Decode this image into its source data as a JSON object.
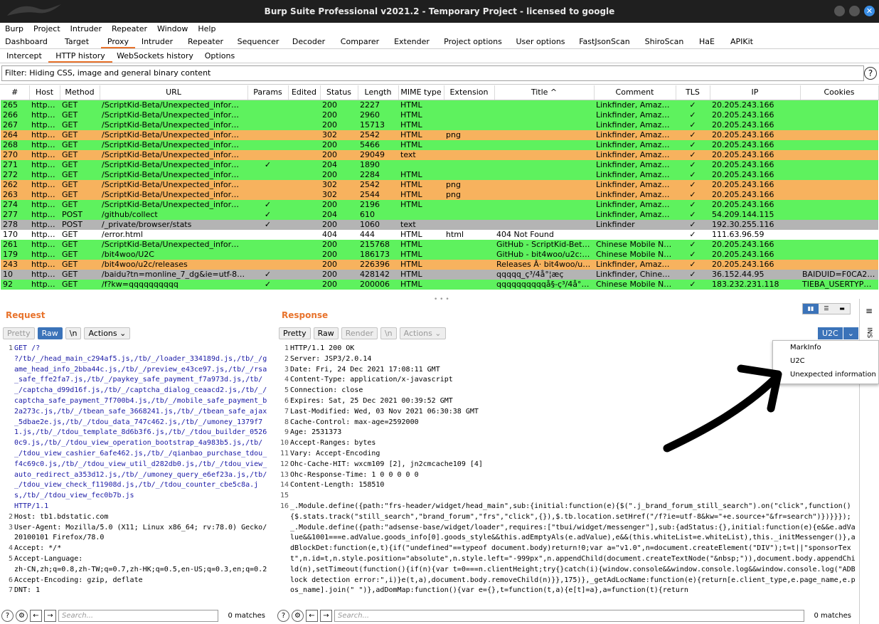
{
  "window": {
    "title": "Burp Suite Professional v2021.2 - Temporary Project - licensed to google"
  },
  "menu": [
    "Burp",
    "Project",
    "Intruder",
    "Repeater",
    "Window",
    "Help"
  ],
  "main_tabs": [
    "Dashboard",
    "Target",
    "Proxy",
    "Intruder",
    "Repeater",
    "Sequencer",
    "Decoder",
    "Comparer",
    "Extender",
    "Project options",
    "User options",
    "FastJsonScan",
    "ShiroScan",
    "HaE",
    "APIKit"
  ],
  "sub_tabs": [
    "Intercept",
    "HTTP history",
    "WebSockets history",
    "Options"
  ],
  "filter": "Filter: Hiding CSS, image and general binary content",
  "columns": [
    "#",
    "Host",
    "Method",
    "URL",
    "Params",
    "Edited",
    "Status",
    "Length",
    "MIME type",
    "Extension",
    "Title ^",
    "Comment",
    "TLS",
    "IP",
    "Cookies"
  ],
  "rows": [
    [
      "265",
      "https:...",
      "GET",
      "/ScriptKid-Beta/Unexpected_information...",
      "",
      "",
      "200",
      "2227",
      "HTML",
      "",
      "",
      "Linkfinder, Amazon...",
      "✓",
      "20.205.243.166",
      "",
      "#5ef25e"
    ],
    [
      "266",
      "https:...",
      "GET",
      "/ScriptKid-Beta/Unexpected_information...",
      "",
      "",
      "200",
      "2960",
      "HTML",
      "",
      "",
      "Linkfinder, Amazon...",
      "✓",
      "20.205.243.166",
      "",
      "#5ef25e"
    ],
    [
      "267",
      "https:...",
      "GET",
      "/ScriptKid-Beta/Unexpected_information...",
      "",
      "",
      "200",
      "15713",
      "HTML",
      "",
      "",
      "Linkfinder, Amazon...",
      "✓",
      "20.205.243.166",
      "",
      "#5ef25e"
    ],
    [
      "264",
      "https:...",
      "GET",
      "/ScriptKid-Beta/Unexpected_information...",
      "",
      "",
      "302",
      "2542",
      "HTML",
      "png",
      "",
      "Linkfinder, Amazon...",
      "✓",
      "20.205.243.166",
      "",
      "#f7b25e"
    ],
    [
      "268",
      "https:...",
      "GET",
      "/ScriptKid-Beta/Unexpected_information...",
      "",
      "",
      "200",
      "5466",
      "HTML",
      "",
      "",
      "Linkfinder, Amazon...",
      "✓",
      "20.205.243.166",
      "",
      "#5ef25e"
    ],
    [
      "270",
      "https:...",
      "GET",
      "/ScriptKid-Beta/Unexpected_information...",
      "",
      "",
      "200",
      "29049",
      "text",
      "",
      "",
      "Linkfinder, Amazon...",
      "✓",
      "20.205.243.166",
      "",
      "#f7b25e"
    ],
    [
      "271",
      "https:...",
      "GET",
      "/ScriptKid-Beta/Unexpected_information...",
      "✓",
      "",
      "204",
      "1890",
      "",
      "",
      "",
      "Linkfinder, Amazon...",
      "✓",
      "20.205.243.166",
      "",
      "#5ef25e"
    ],
    [
      "272",
      "https:...",
      "GET",
      "/ScriptKid-Beta/Unexpected_information...",
      "",
      "",
      "200",
      "2284",
      "HTML",
      "",
      "",
      "Linkfinder, Amazon...",
      "✓",
      "20.205.243.166",
      "",
      "#5ef25e"
    ],
    [
      "262",
      "https:...",
      "GET",
      "/ScriptKid-Beta/Unexpected_information...",
      "",
      "",
      "302",
      "2542",
      "HTML",
      "png",
      "",
      "Linkfinder, Amazon...",
      "✓",
      "20.205.243.166",
      "",
      "#f7b25e"
    ],
    [
      "263",
      "https:...",
      "GET",
      "/ScriptKid-Beta/Unexpected_information...",
      "",
      "",
      "302",
      "2544",
      "HTML",
      "png",
      "",
      "Linkfinder, Amazon...",
      "✓",
      "20.205.243.166",
      "",
      "#f7b25e"
    ],
    [
      "274",
      "https:...",
      "GET",
      "/ScriptKid-Beta/Unexpected_information...",
      "✓",
      "",
      "200",
      "2196",
      "HTML",
      "",
      "",
      "Linkfinder, Amazon...",
      "✓",
      "20.205.243.166",
      "",
      "#5ef25e"
    ],
    [
      "277",
      "https:...",
      "POST",
      "/github/collect",
      "✓",
      "",
      "204",
      "610",
      "",
      "",
      "",
      "Linkfinder, Amazon...",
      "✓",
      "54.209.144.115",
      "",
      "#5ef25e"
    ],
    [
      "278",
      "https:...",
      "POST",
      "/_private/browser/stats",
      "✓",
      "",
      "200",
      "1060",
      "text",
      "",
      "",
      "Linkfinder",
      "✓",
      "192.30.255.116",
      "",
      "#b4b4b4"
    ],
    [
      "170",
      "https:...",
      "GET",
      "/error.html",
      "",
      "",
      "404",
      "444",
      "HTML",
      "html",
      "404 Not Found",
      "",
      "✓",
      "111.63.96.59",
      "",
      "#ffffff"
    ],
    [
      "261",
      "https:...",
      "GET",
      "/ScriptKid-Beta/Unexpected_information",
      "",
      "",
      "200",
      "215768",
      "HTML",
      "",
      "GitHub - ScriptKid-Beta/U...",
      "Chinese Mobile Nu...",
      "✓",
      "20.205.243.166",
      "",
      "#5ef25e"
    ],
    [
      "179",
      "https:...",
      "GET",
      "/bit4woo/U2C",
      "",
      "",
      "200",
      "186173",
      "HTML",
      "",
      "GitHub - bit4woo/u2c: Uni...",
      "Chinese Mobile Nu...",
      "✓",
      "20.205.243.166",
      "",
      "#5ef25e"
    ],
    [
      "243",
      "https:...",
      "GET",
      "/bit4woo/u2c/releases",
      "",
      "",
      "200",
      "226396",
      "HTML",
      "",
      "Releases Â· bit4woo/u2c Â...",
      "Linkfinder, Amazon...",
      "✓",
      "20.205.243.166",
      "",
      "#f7b25e"
    ],
    [
      "10",
      "https:...",
      "GET",
      "/baidu?tn=monline_7_dg&ie=utf-8&wd=...",
      "✓",
      "",
      "200",
      "428142",
      "HTML",
      "",
      "qqqqq_ç³/4å°¦æç",
      "Linkfinder, Chinese...",
      "✓",
      "36.152.44.95",
      "BAIDUID=F0CA26E...",
      "#b4b4b4"
    ],
    [
      "92",
      "https:...",
      "GET",
      "/f?kw=qqqqqqqqqq",
      "✓",
      "",
      "200",
      "200006",
      "HTML",
      "",
      "qqqqqqqqqqå§-ç³/4å°¦è¨...",
      "Chinese Mobile Nu...",
      "✓",
      "183.232.231.118",
      "TIEBA_USERTYPE=...",
      "#5ef25e"
    ]
  ],
  "request": {
    "header": "Request",
    "tools": [
      "Pretty",
      "Raw",
      "\\n",
      "Actions ⌄"
    ],
    "lines": [
      [
        "1",
        "GET /?\n?/tb/_/head_main_c294af5.js,/tb/_/loader_334189d.js,/tb/_/game_head_info_2bba44c.js,/tb/_/preview_e43ce97.js,/tb/_/rsa_safe_ffe2fa7.js,/tb/_/paykey_safe_payment_f7a973d.js,/tb/_/captcha_d99d16f.js,/tb/_/captcha_dialog_ceaacd2.js,/tb/_/captcha_safe_payment_7f700b4.js,/tb/_/mobile_safe_payment_b2a273c.js,/tb/_/tbean_safe_3668241.js,/tb/_/tbean_safe_ajax_5dbae2e.js,/tb/_/tdou_data_747c462.js,/tb/_/umoney_1379f71.js,/tb/_/tdou_template_8d6b3f6.js,/tb/_/tdou_builder_05260c9.js,/tb/_/tdou_view_operation_bootstrap_4a983b5.js,/tb/_/tdou_view_cashier_6afe462.js,/tb/_/qianbao_purchase_tdou_f4c69c0.js,/tb/_/tdou_view_util_d282db0.js,/tb/_/tdou_view_auto_redirect_a353d12.js,/tb/_/umoney_query_e6ef23a.js,/tb/_/tdou_view_check_f11908d.js,/tb/_/tdou_counter_cbe5c8a.js,/tb/_/tdou_view_fec0b7b.js\nHTTP/1.1"
      ],
      [
        "2",
        "Host: tb1.bdstatic.com"
      ],
      [
        "3",
        "User-Agent: Mozilla/5.0 (X11; Linux x86_64; rv:78.0) Gecko/20100101 Firefox/78.0"
      ],
      [
        "4",
        "Accept: */*"
      ],
      [
        "5",
        "Accept-Language:\nzh-CN,zh;q=0.8,zh-TW;q=0.7,zh-HK;q=0.5,en-US;q=0.3,en;q=0.2"
      ],
      [
        "6",
        "Accept-Encoding: gzip, deflate"
      ],
      [
        "7",
        "DNT: 1"
      ]
    ],
    "search_placeholder": "Search...",
    "matches": "0 matches"
  },
  "response": {
    "header": "Response",
    "tools": [
      "Pretty",
      "Raw",
      "Render",
      "\\n",
      "Actions ⌄"
    ],
    "lines": [
      [
        "1",
        "HTTP/1.1 200 OK"
      ],
      [
        "2",
        "Server: JSP3/2.0.14"
      ],
      [
        "3",
        "Date: Fri, 24 Dec 2021 17:08:11 GMT"
      ],
      [
        "4",
        "Content-Type: application/x-javascript"
      ],
      [
        "5",
        "Connection: close"
      ],
      [
        "6",
        "Expires: Sat, 25 Dec 2021 00:39:52 GMT"
      ],
      [
        "7",
        "Last-Modified: Wed, 03 Nov 2021 06:30:38 GMT"
      ],
      [
        "8",
        "Cache-Control: max-age=2592000"
      ],
      [
        "9",
        "Age: 2531373"
      ],
      [
        "10",
        "Accept-Ranges: bytes"
      ],
      [
        "11",
        "Vary: Accept-Encoding"
      ],
      [
        "12",
        "Ohc-Cache-HIT: wxcm109 [2], jn2cmcache109 [4]"
      ],
      [
        "13",
        "Ohc-Response-Time: 1 0 0 0 0 0"
      ],
      [
        "14",
        "Content-Length: 158510"
      ],
      [
        "15",
        ""
      ],
      [
        "16",
        "_.Module.define({path:\"frs-header/widget/head_main\",sub:{initial:function(e){$(\".j_brand_forum_still_search\").on(\"click\",function(){$.stats.track(\"still_search\",\"brand_forum\",\"frs\",\"click\",{}),$.tb.location.setHref(\"/f?ie=utf-8&kw=\"+e.source+\"&fr=search\")})}}});_.Module.define({path:\"adsense-base/widget/loader\",requires:[\"tbui/widget/messenger\"],sub:{adStatus:{},initial:function(e){e&&e.adValue&&1001===e.adValue.goods_info[0].goods_style&&this.adEmptyAls(e.adValue),e&&(this.whiteList=e.whiteList),this._initMessenger()},adBlockDet:function(e,t){if(\"undefined\"==typeof document.body)return!0;var a=\"v1.0\",n=document.createElement(\"DIV\");t=t||\"sponsorText\",n.id=t,n.style.position=\"absolute\",n.style.left=\"-999px\",n.appendChild(document.createTextNode(\"&nbsp;\")),document.body.appendChild(n),setTimeout(function(){if(n){var t=0===n.clientHeight;try{}catch(i){window.console&&window.console.log&&window.console.log(\"ADBlock detection error:\",i)}e(t,a),document.body.removeChild(n)}},175)},_getAdLocName:function(e){return[e.client_type,e.page_name,e.pos_name].join(\" \")},adDomMap:function(){var e={},t=function(t,a){e[t]=a},a=function(t){return"
      ]
    ],
    "search_placeholder": "Search...",
    "matches": "0 matches"
  },
  "u2c": {
    "label": "U2C",
    "menu": [
      "MarkInfo",
      "U2C",
      "Unexpected information"
    ]
  },
  "colors": {
    "accent": "#e8732c",
    "selected": "#3b73b9"
  }
}
